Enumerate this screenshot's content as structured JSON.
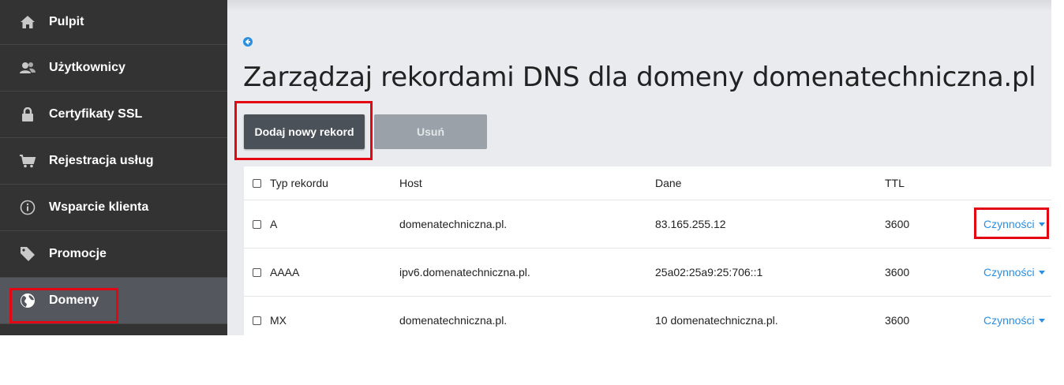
{
  "sidebar": {
    "items": [
      {
        "label": "Pulpit",
        "icon": "home-icon"
      },
      {
        "label": "Użytkownicy",
        "icon": "users-icon"
      },
      {
        "label": "Certyfikaty SSL",
        "icon": "lock-icon"
      },
      {
        "label": "Rejestracja usług",
        "icon": "cart-icon"
      },
      {
        "label": "Wsparcie klienta",
        "icon": "info-icon"
      },
      {
        "label": "Promocje",
        "icon": "tag-icon"
      },
      {
        "label": "Domeny",
        "icon": "globe-icon",
        "active": true
      }
    ]
  },
  "main": {
    "title": "Zarządzaj rekordami DNS dla domeny domenatechniczna.pl",
    "buttons": {
      "add": "Dodaj nowy rekord",
      "delete": "Usuń"
    }
  },
  "table": {
    "headers": {
      "type": "Typ rekordu",
      "host": "Host",
      "data": "Dane",
      "ttl": "TTL"
    },
    "rows": [
      {
        "type": "A",
        "host": "domenatechniczna.pl.",
        "data": "83.165.255.12",
        "ttl": "3600",
        "action": "Czynności"
      },
      {
        "type": "AAAA",
        "host": "ipv6.domenatechniczna.pl.",
        "data": "25a02:25a9:25:706::1",
        "ttl": "3600",
        "action": "Czynności"
      },
      {
        "type": "MX",
        "host": "domenatechniczna.pl.",
        "data": "10 domenatechniczna.pl.",
        "ttl": "3600",
        "action": "Czynności"
      }
    ]
  },
  "colors": {
    "accent": "#2a8fe0",
    "highlight": "#e30613",
    "sidebar": "#333333",
    "active": "#54585e"
  }
}
